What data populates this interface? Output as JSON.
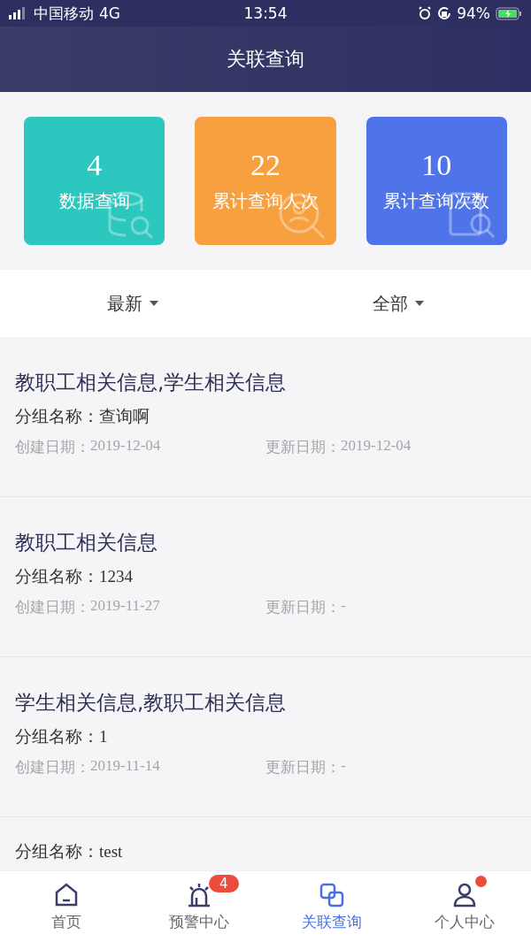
{
  "status_bar": {
    "carrier": "中国移动",
    "network": "4G",
    "time": "13:54",
    "battery": "94%"
  },
  "header": {
    "title": "关联查询"
  },
  "stat_cards": [
    {
      "value": "4",
      "label": "数据查询",
      "color": "#2cc7bf"
    },
    {
      "value": "22",
      "label": "累计查询人次",
      "color": "#f7a040"
    },
    {
      "value": "10",
      "label": "累计查询次数",
      "color": "#4f73e8"
    }
  ],
  "filters": [
    {
      "label": "最新"
    },
    {
      "label": "全部"
    }
  ],
  "records": [
    {
      "title": "教职工相关信息,学生相关信息",
      "group_label": "分组名称：",
      "group": "查询啊",
      "created_label": "创建日期：",
      "created": "2019-12-04",
      "updated_label": "更新日期：",
      "updated": "2019-12-04"
    },
    {
      "title": "教职工相关信息",
      "group_label": "分组名称：",
      "group": "1234",
      "created_label": "创建日期：",
      "created": "2019-11-27",
      "updated_label": "更新日期：",
      "updated": "-"
    },
    {
      "title": "学生相关信息,教职工相关信息",
      "group_label": "分组名称：",
      "group": "1",
      "created_label": "创建日期：",
      "created": "2019-11-14",
      "updated_label": "更新日期：",
      "updated": "-"
    },
    {
      "group_label": "分组名称：",
      "group": "test"
    }
  ],
  "tab_bar": [
    {
      "label": "首页",
      "selected": false
    },
    {
      "label": "预警中心",
      "selected": false,
      "badge": "4"
    },
    {
      "label": "关联查询",
      "selected": true
    },
    {
      "label": "个人中心",
      "selected": false,
      "dot": true
    }
  ]
}
